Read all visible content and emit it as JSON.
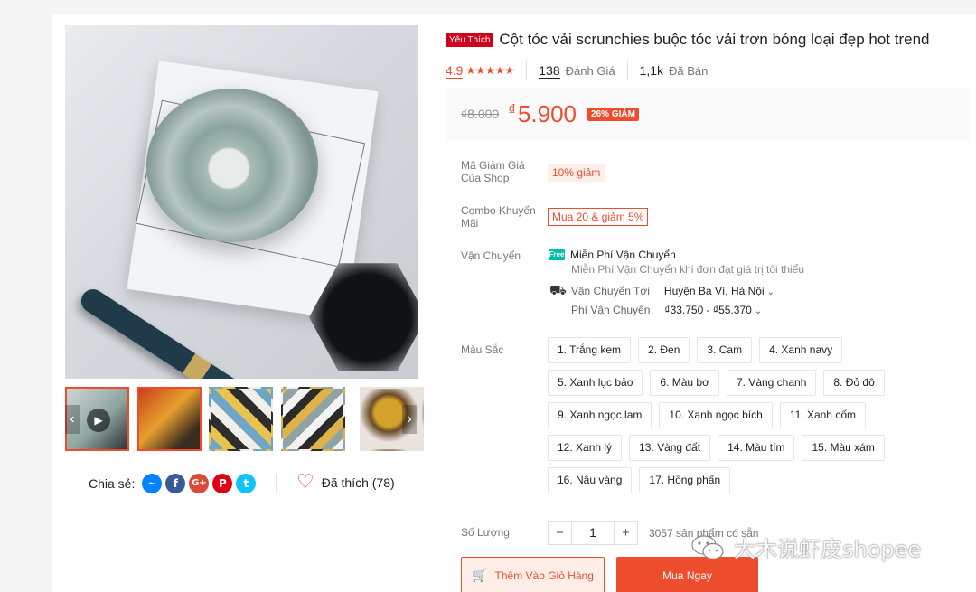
{
  "product": {
    "badge": "Yêu Thích",
    "title": "Cột tóc vải scrunchies buộc tóc vải trơn bóng loại đẹp hot trend",
    "rating": "4.9",
    "stars": "★★★★★",
    "reviews_count": "138",
    "reviews_label": "Đánh Giá",
    "sold_count": "1,1k",
    "sold_label": "Đã Bán"
  },
  "price": {
    "original": "₫8.000",
    "currency": "₫",
    "current": "5.900",
    "discount": "26% GIẢM"
  },
  "voucher": {
    "label": "Mã Giảm Giá Của Shop",
    "value": "10% giảm"
  },
  "combo": {
    "label": "Combo Khuyến Mãi",
    "value": "Mua 20 & giảm 5%"
  },
  "shipping": {
    "label": "Vận Chuyển",
    "free_icon": "Free",
    "free_title": "Miễn Phí Vận Chuyển",
    "free_desc": "Miễn Phí Vận Chuyển khi đơn đạt giá trị tối thiểu",
    "to_label": "Vận Chuyển Tới",
    "to_value": "Huyện Ba Vì, Hà Nội",
    "fee_label": "Phí Vận Chuyển",
    "fee_value": "₫33.750 - ₫55.370"
  },
  "color": {
    "label": "Màu Sắc",
    "options": [
      "1. Trắng kem",
      "2. Đen",
      "3. Cam",
      "4. Xanh navy",
      "5. Xanh lục bảo",
      "6. Màu bơ",
      "7. Vàng chanh",
      "8. Đỏ đô",
      "9. Xanh ngọc lam",
      "10. Xanh ngọc bích",
      "11. Xanh cốm",
      "12. Xanh lý",
      "13. Vàng đất",
      "14. Màu tím",
      "15. Màu xám",
      "16. Nâu vàng",
      "17. Hồng phấn"
    ]
  },
  "quantity": {
    "label": "Số Lượng",
    "minus": "−",
    "value": "1",
    "plus": "+",
    "stock": "3057 sản phẩm có sẵn"
  },
  "actions": {
    "add_to_cart": "Thêm Vào Giỏ Hàng",
    "buy_now": "Mua Ngay"
  },
  "share": {
    "label": "Chia sẻ:",
    "icons": [
      "messenger-icon",
      "facebook-icon",
      "google-plus-icon",
      "pinterest-icon",
      "twitter-icon"
    ]
  },
  "like": {
    "label": "Đã thích (78)"
  },
  "watermark": "大木说虾皮shopee",
  "colors": {
    "accent": "#ee4d2d",
    "favorite": "#d0011b",
    "free_ship": "#00bfa5"
  }
}
